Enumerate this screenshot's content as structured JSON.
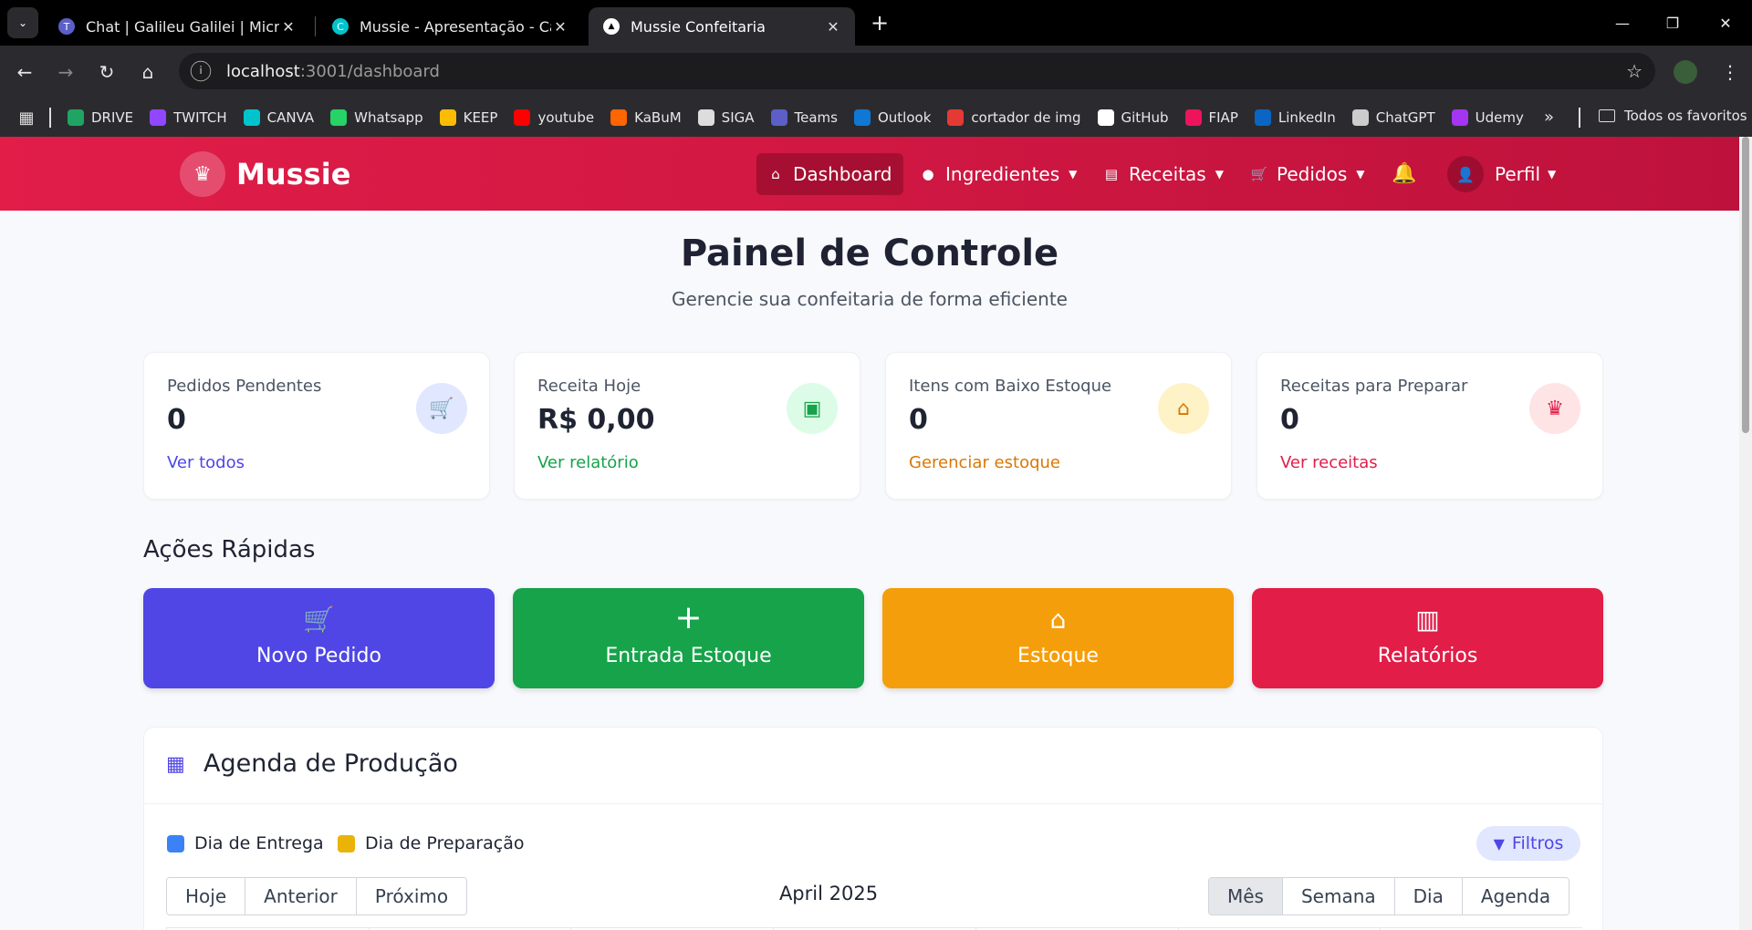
{
  "browser": {
    "tabs": [
      {
        "title": "Chat | Galileu Galilei | Microsoft",
        "icon": "teams-icon"
      },
      {
        "title": "Mussie - Apresentação - Canva",
        "icon": "canva-icon"
      },
      {
        "title": "Mussie Confeitaria",
        "icon": "vercel-icon"
      }
    ],
    "url_host": "localhost",
    "url_path": ":3001/dashboard",
    "bookmarks": [
      {
        "label": "DRIVE",
        "color": "#1fa463"
      },
      {
        "label": "TWITCH",
        "color": "#9146ff"
      },
      {
        "label": "CANVA",
        "color": "#00c4cc"
      },
      {
        "label": "Whatsapp",
        "color": "#25d366"
      },
      {
        "label": "KEEP",
        "color": "#fbbc04"
      },
      {
        "label": "youtube",
        "color": "#ff0000"
      },
      {
        "label": "KaBuM",
        "color": "#ff6500"
      },
      {
        "label": "SIGA",
        "color": "#dddddd"
      },
      {
        "label": "Teams",
        "color": "#5b5fc7"
      },
      {
        "label": "Outlook",
        "color": "#0f78d4"
      },
      {
        "label": "cortador de img",
        "color": "#e53935"
      },
      {
        "label": "GitHub",
        "color": "#ffffff"
      },
      {
        "label": "FIAP",
        "color": "#ed145b"
      },
      {
        "label": "LinkedIn",
        "color": "#0a66c2"
      },
      {
        "label": "ChatGPT",
        "color": "#cccccc"
      },
      {
        "label": "Udemy",
        "color": "#a435f0"
      }
    ],
    "all_bookmarks": "Todos os favoritos"
  },
  "nav": {
    "brand": "Mussie",
    "items": [
      {
        "label": "Dashboard",
        "icon": "home-icon"
      },
      {
        "label": "Ingredientes",
        "icon": "cookie-icon"
      },
      {
        "label": "Receitas",
        "icon": "list-icon"
      },
      {
        "label": "Pedidos",
        "icon": "cart-icon"
      }
    ],
    "profile": "Perfil"
  },
  "header": {
    "title": "Painel de Controle",
    "subtitle": "Gerencie sua confeitaria de forma eficiente"
  },
  "stats": [
    {
      "label": "Pedidos Pendentes",
      "value": "0",
      "link": "Ver todos",
      "color": "#4f46e5",
      "bg": "#e0e7ff",
      "icon": "cart-icon"
    },
    {
      "label": "Receita Hoje",
      "value": "R$ 0,00",
      "link": "Ver relatório",
      "color": "#16a34a",
      "bg": "#dcfce7",
      "icon": "money-icon"
    },
    {
      "label": "Itens com Baixo Estoque",
      "value": "0",
      "link": "Gerenciar estoque",
      "color": "#d97706",
      "bg": "#fef3c7",
      "icon": "warehouse-icon"
    },
    {
      "label": "Receitas para Preparar",
      "value": "0",
      "link": "Ver receitas",
      "color": "#e11d48",
      "bg": "#ffe4e6",
      "icon": "chef-icon"
    }
  ],
  "quick_actions": {
    "title": "Ações Rápidas",
    "items": [
      {
        "label": "Novo Pedido",
        "color": "#4f46e5",
        "icon": "cart-icon"
      },
      {
        "label": "Entrada Estoque",
        "color": "#16a34a",
        "icon": "plus-icon"
      },
      {
        "label": "Estoque",
        "color": "#f59e0b",
        "icon": "warehouse-icon"
      },
      {
        "label": "Relatórios",
        "color": "#e11d48",
        "icon": "chart-icon"
      }
    ]
  },
  "agenda": {
    "title": "Agenda de Produção",
    "legend": [
      {
        "label": "Dia de Entrega",
        "color": "#3b82f6"
      },
      {
        "label": "Dia de Preparação",
        "color": "#eab308"
      }
    ],
    "filters": "Filtros",
    "nav_buttons": [
      "Hoje",
      "Anterior",
      "Próximo"
    ],
    "month": "April 2025",
    "views": [
      "Mês",
      "Semana",
      "Dia",
      "Agenda"
    ],
    "active_view": "Mês"
  }
}
